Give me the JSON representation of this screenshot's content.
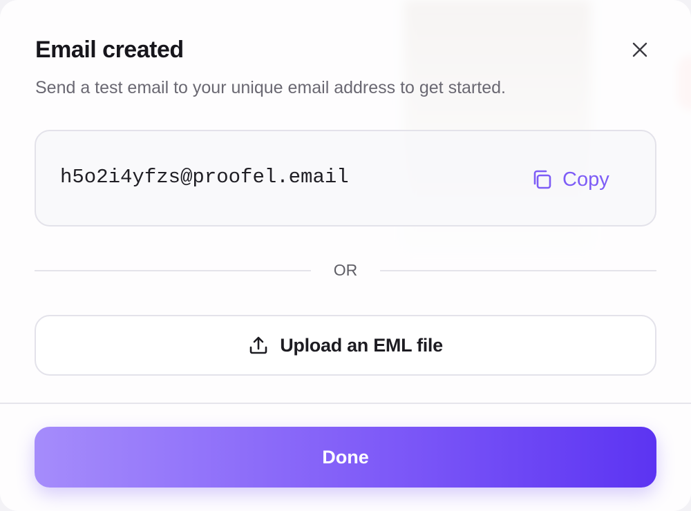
{
  "modal": {
    "title": "Email created",
    "subtitle": "Send a test email to your unique email address to get started.",
    "close_icon": "close-icon"
  },
  "email_box": {
    "address": "h5o2i4yfzs@proofel.email",
    "copy_label": "Copy",
    "copy_icon": "copy-icon"
  },
  "divider": {
    "label": "OR"
  },
  "upload": {
    "label": "Upload an EML file",
    "icon": "upload-icon"
  },
  "footer": {
    "done_label": "Done"
  },
  "colors": {
    "accent": "#7d5cf6",
    "done_gradient_start": "#a58cfb",
    "done_gradient_end": "#5c34f2",
    "title_text": "#17161c",
    "muted_text": "#6a6872"
  }
}
